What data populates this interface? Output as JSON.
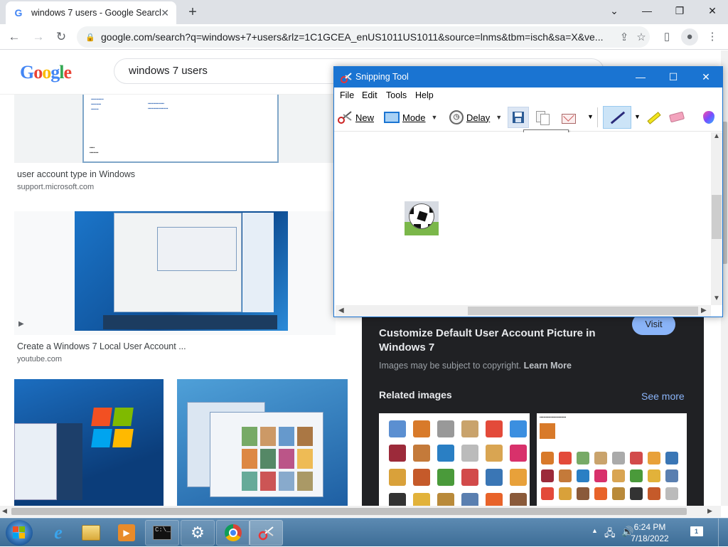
{
  "browser": {
    "tab_title": "windows 7 users - Google Search",
    "url": "google.com/search?q=windows+7+users&rlz=1C1GCEA_enUS1011US1011&source=lnms&tbm=isch&sa=X&ve..."
  },
  "google": {
    "logo_text": "Google",
    "search_value": "windows 7 users"
  },
  "results": [
    {
      "caption": "user account type in Windows",
      "source": "support.microsoft.com"
    },
    {
      "caption": "Create a Windows 7 Local User Account ...",
      "source": "youtube.com"
    }
  ],
  "panel": {
    "title": "Customize Default User Account Picture in Windows 7",
    "visit_label": "Visit",
    "copyright_prefix": "Images may be subject to copyright.",
    "learn_more": "Learn More",
    "related_label": "Related images",
    "see_more": "See more"
  },
  "snipping_tool": {
    "title": "Snipping Tool",
    "menu": [
      "File",
      "Edit",
      "Tools",
      "Help"
    ],
    "new_label": "New",
    "mode_label": "Mode",
    "delay_label": "Delay",
    "tooltip": "Save Snip"
  },
  "taskbar": {
    "time": "6:24 PM",
    "date": "7/18/2022"
  },
  "colors": {
    "chrome_tabstrip": "#dee1e6",
    "snip_titlebar": "#1a74d2",
    "panel_bg": "#202124",
    "link_blue": "#8ab4f8"
  }
}
